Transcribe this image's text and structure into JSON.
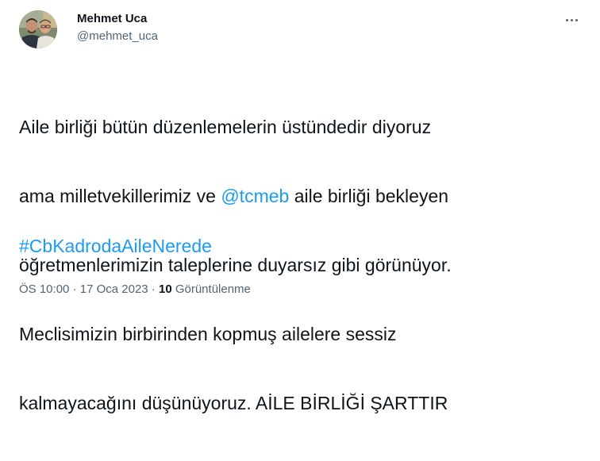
{
  "author": {
    "display_name": "Mehmet Uca",
    "handle": "@mehmet_uca",
    "avatar_icon": "profile-photo"
  },
  "tweet": {
    "line1": "Aile birliği bütün düzenlemelerin üstündedir diyoruz",
    "line2_pre": "ama milletvekillerimiz ve ",
    "mention": "@tcmeb",
    "line2_post": " aile birliği bekleyen",
    "line3": "öğretmenlerimizin taleplerine duyarsız gibi görünüyor.",
    "line4": "Meclisimizin birbirinden kopmuş ailelere sessiz",
    "line5": "kalmayacağını düşünüyoruz. AİLE BİRLİĞİ ŞARTTIR",
    "hashtag": "#CbKadrodaAileNerede"
  },
  "meta": {
    "time": "ÖS 10:00",
    "sep1": " · ",
    "date": "17 Oca 2023",
    "sep2": " · ",
    "views_count": "10",
    "views_label": " Görüntülenme"
  },
  "colors": {
    "link": "#1d9bf0",
    "text": "#0f1419",
    "secondary": "#536471"
  },
  "icons": {
    "more": "more-horizontal-icon"
  }
}
